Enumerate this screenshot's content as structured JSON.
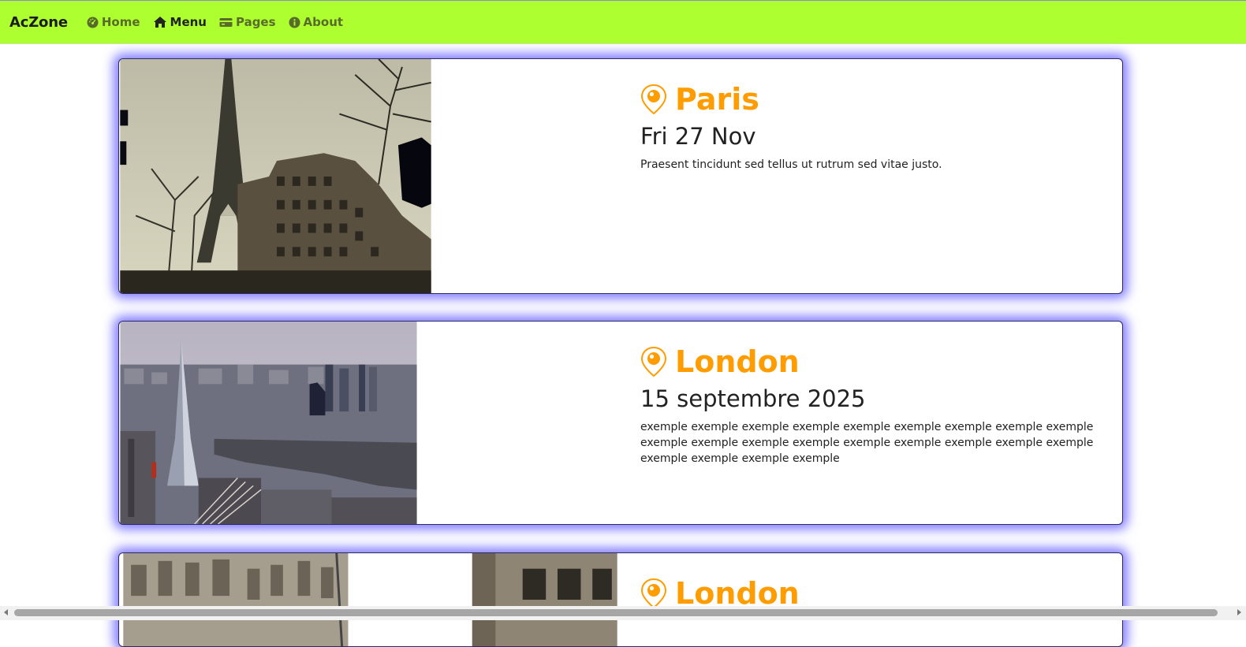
{
  "nav": {
    "brand": "AcZone",
    "items": [
      {
        "label": "Home",
        "icon": "dashboard-icon"
      },
      {
        "label": "Menu",
        "icon": "house-icon"
      },
      {
        "label": "Pages",
        "icon": "card-icon"
      },
      {
        "label": "About",
        "icon": "info-circle-icon"
      }
    ],
    "bg_color": "#adff2f"
  },
  "cards": [
    {
      "city": "Paris",
      "date": "Fri 27 Nov",
      "description": "Praesent tincidunt sed tellus ut rutrum sed vitae justo.",
      "image": "eiffel-tower-street-photo"
    },
    {
      "city": "London",
      "date": "15 septembre 2025",
      "description": "exemple exemple exemple exemple exemple exemple exemple exemple exemple exemple exemple exemple exemple exemple exemple exemple exemple exemple exemple exemple exemple exemple",
      "image": "london-skyline-aerial-photo"
    },
    {
      "city": "London",
      "image": "london-street-buildings-photo"
    }
  ],
  "colors": {
    "accent": "#ff9d00",
    "card_glow": "#5a50ff"
  }
}
